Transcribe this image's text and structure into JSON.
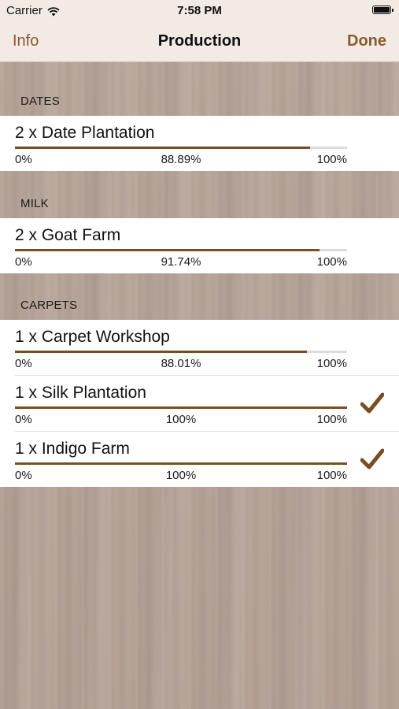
{
  "status": {
    "carrier": "Carrier",
    "time": "7:58 PM"
  },
  "nav": {
    "left": "Info",
    "title": "Production",
    "right": "Done"
  },
  "accent_color": "#7a4e22",
  "sections": [
    {
      "header": "DATES",
      "rows": [
        {
          "title": "2 x Date Plantation",
          "min": "0%",
          "value_label": "88.89%",
          "max": "100%",
          "progress": 0.8889,
          "done": false
        }
      ]
    },
    {
      "header": "MILK",
      "rows": [
        {
          "title": "2 x Goat Farm",
          "min": "0%",
          "value_label": "91.74%",
          "max": "100%",
          "progress": 0.9174,
          "done": false
        }
      ]
    },
    {
      "header": "CARPETS",
      "rows": [
        {
          "title": "1 x Carpet Workshop",
          "min": "0%",
          "value_label": "88.01%",
          "max": "100%",
          "progress": 0.8801,
          "done": false
        },
        {
          "title": "1 x Silk Plantation",
          "min": "0%",
          "value_label": "100%",
          "max": "100%",
          "progress": 1.0,
          "done": true,
          "icon": "checkmark-icon"
        },
        {
          "title": "1 x Indigo Farm",
          "min": "0%",
          "value_label": "100%",
          "max": "100%",
          "progress": 1.0,
          "done": true,
          "icon": "checkmark-icon"
        }
      ]
    }
  ]
}
